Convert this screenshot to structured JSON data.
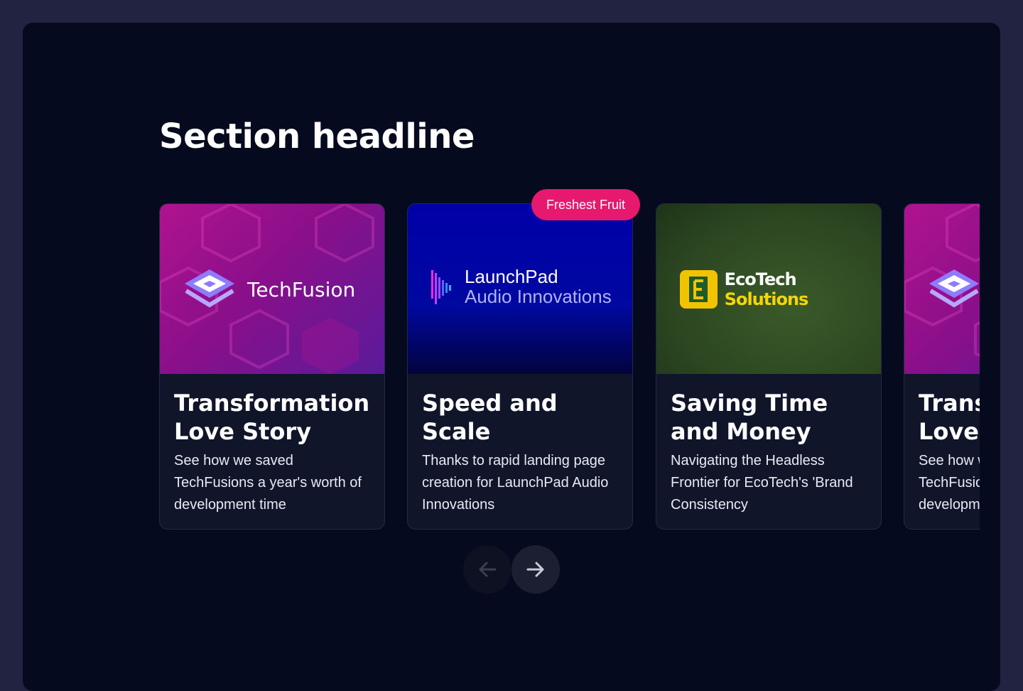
{
  "section": {
    "headline": "Section headline"
  },
  "badge": {
    "label": "Freshest Fruit"
  },
  "cards": [
    {
      "brand": "TechFusion",
      "title": "Transformation Love Story",
      "description": "See how we saved TechFusions a year's worth of development time"
    },
    {
      "brand_top": "LaunchPad",
      "brand_bottom": "Audio Innovations",
      "title": "Speed and Scale",
      "description": "Thanks to rapid landing page creation for LaunchPad Audio Innovations"
    },
    {
      "brand_a": "EcoTech",
      "brand_b": "Solutions",
      "title": "Saving Time and Money",
      "description": "Navigating the Headless Frontier for EcoTech's 'Brand Consistency"
    },
    {
      "title": "Transformation Love Story",
      "description": "See how we saved TechFusions a year's worth of development time"
    }
  ],
  "nav": {
    "prev_icon": "arrow-left-icon",
    "next_icon": "arrow-right-icon"
  },
  "colors": {
    "page_bg": "#222340",
    "panel_bg": "#050a1f",
    "card_bg": "#10152a",
    "badge": "#e6196f",
    "eco_yellow": "#f6d500"
  }
}
